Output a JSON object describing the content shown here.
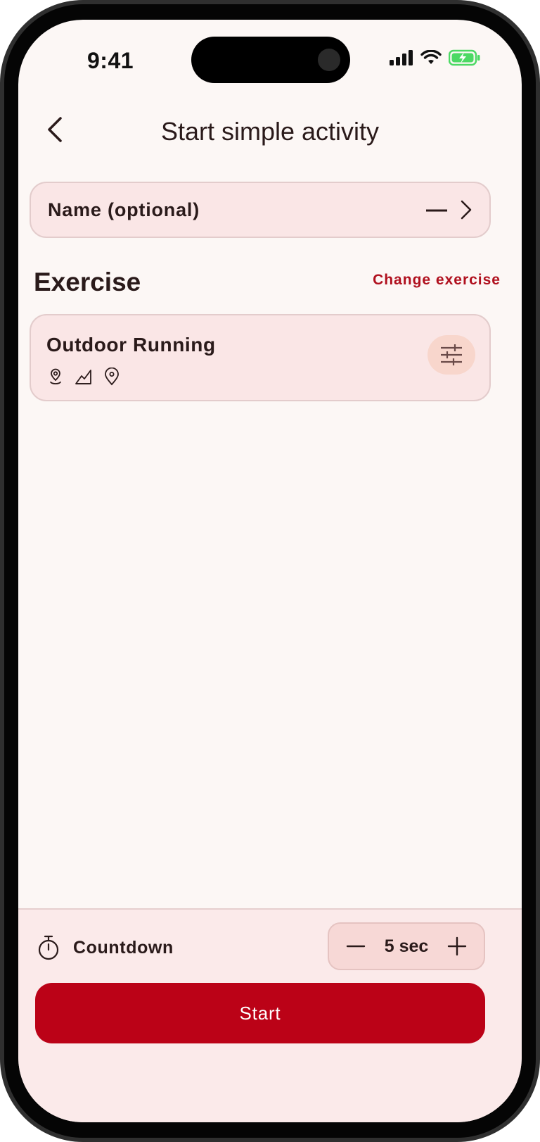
{
  "status_bar": {
    "time": "9:41",
    "battery_color": "#4cd964"
  },
  "header": {
    "back_icon": "chevron-left-icon",
    "title": "Start simple activity"
  },
  "name_field": {
    "label": "Name (optional)",
    "value": "—",
    "chevron_icon": "chevron-right-icon"
  },
  "exercise_section": {
    "title": "Exercise",
    "change_label": "Change exercise",
    "exercise": {
      "name": "Outdoor Running",
      "feature_icons": [
        "route-pin-icon",
        "elevation-icon",
        "location-pin-icon"
      ],
      "settings_icon": "sliders-icon"
    }
  },
  "countdown": {
    "icon": "stopwatch-icon",
    "label": "Countdown",
    "value": "5 sec",
    "minus_icon": "minus-icon",
    "plus_icon": "plus-icon"
  },
  "start_button": {
    "label": "Start",
    "color": "#bb0217"
  },
  "colors": {
    "accent": "#b0101e",
    "card_bg": "#fae6e6",
    "screen_bg": "#fcf7f5"
  }
}
